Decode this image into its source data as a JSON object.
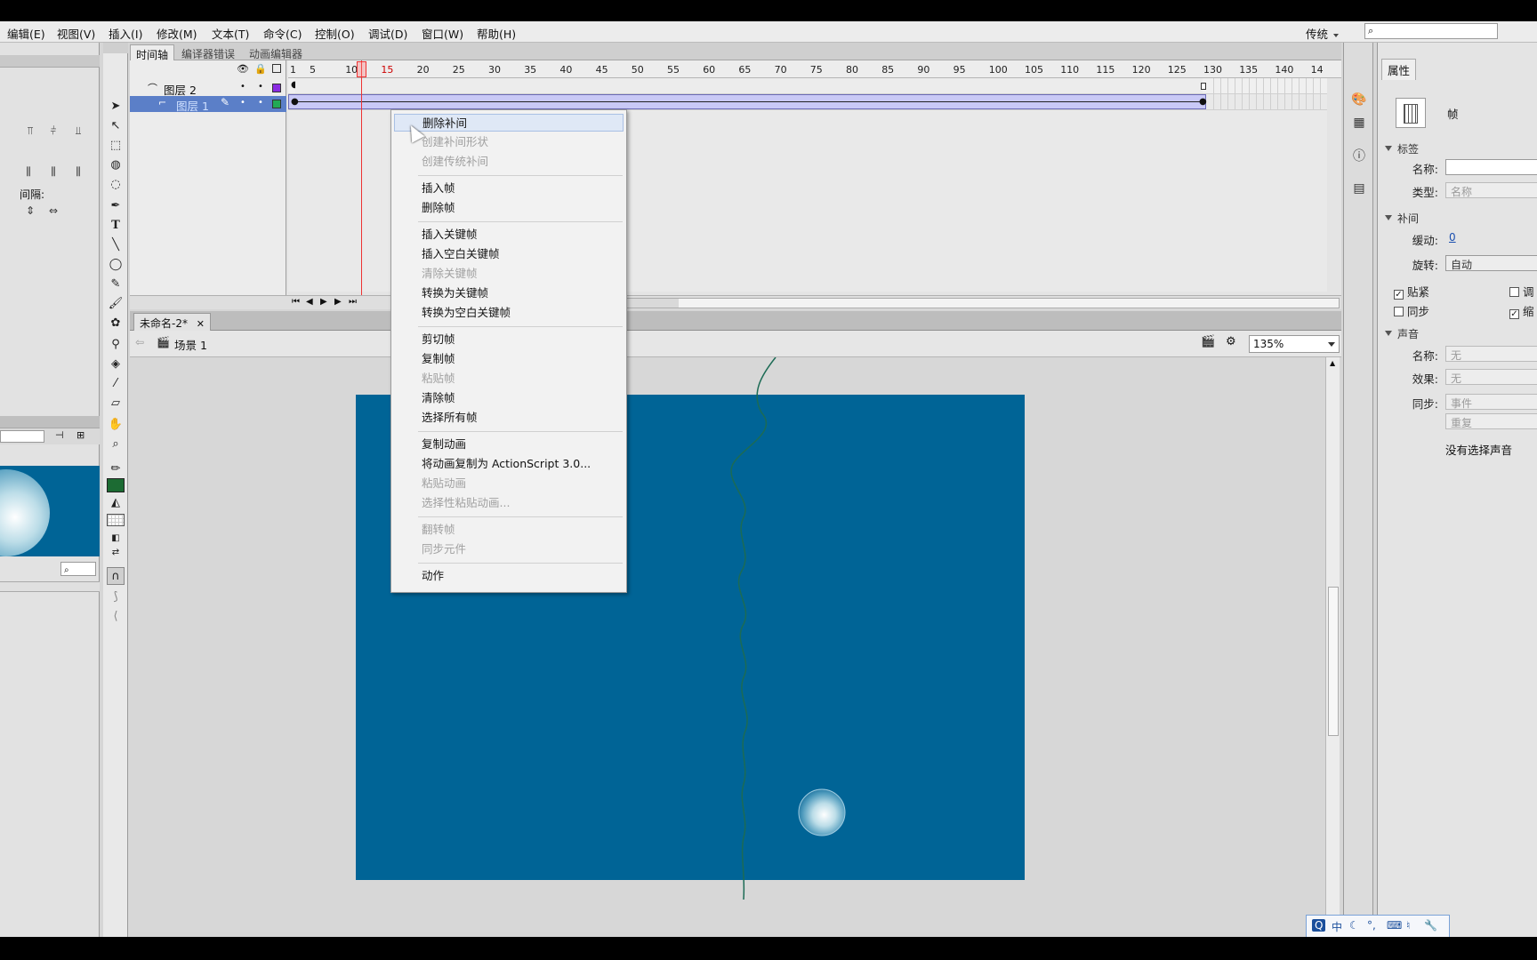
{
  "menubar": {
    "items": [
      "编辑(E)",
      "视图(V)",
      "插入(I)",
      "修改(M)",
      "文本(T)",
      "命令(C)",
      "控制(O)",
      "调试(D)",
      "窗口(W)",
      "帮助(H)"
    ],
    "workspace": "传统"
  },
  "left_panel": {
    "spacing_label": "间隔:"
  },
  "timeline": {
    "tabs": [
      "时间轴",
      "编译器错误",
      "动画编辑器"
    ],
    "layers": [
      {
        "name": "图层 2",
        "color": "#8a2be2"
      },
      {
        "name": "图层 1",
        "color": "#22aa55"
      }
    ],
    "frame_numbers": [
      "1",
      "5",
      "10",
      "15",
      "20",
      "25",
      "30",
      "35",
      "40",
      "45",
      "50",
      "55",
      "60",
      "65",
      "70",
      "75",
      "80",
      "85",
      "90",
      "95",
      "100",
      "105",
      "110",
      "115",
      "120",
      "125",
      "130",
      "135",
      "140",
      "14"
    ],
    "current_frame": 15
  },
  "document": {
    "tab_title": "未命名-2*",
    "scene": "场景 1",
    "zoom": "135%",
    "stage_color": "#006496"
  },
  "context_menu": {
    "items": [
      {
        "label": "删除补间",
        "enabled": true,
        "hover": true
      },
      {
        "label": "创建补间形状",
        "enabled": false
      },
      {
        "label": "创建传统补间",
        "enabled": false
      },
      {
        "sep": true
      },
      {
        "label": "插入帧",
        "enabled": true
      },
      {
        "label": "删除帧",
        "enabled": true
      },
      {
        "sep": true
      },
      {
        "label": "插入关键帧",
        "enabled": true
      },
      {
        "label": "插入空白关键帧",
        "enabled": true
      },
      {
        "label": "清除关键帧",
        "enabled": false
      },
      {
        "label": "转换为关键帧",
        "enabled": true
      },
      {
        "label": "转换为空白关键帧",
        "enabled": true
      },
      {
        "sep": true
      },
      {
        "label": "剪切帧",
        "enabled": true
      },
      {
        "label": "复制帧",
        "enabled": true
      },
      {
        "label": "粘贴帧",
        "enabled": false
      },
      {
        "label": "清除帧",
        "enabled": true
      },
      {
        "label": "选择所有帧",
        "enabled": true
      },
      {
        "sep": true
      },
      {
        "label": "复制动画",
        "enabled": true
      },
      {
        "label": "将动画复制为 ActionScript 3.0...",
        "enabled": true
      },
      {
        "label": "粘贴动画",
        "enabled": false
      },
      {
        "label": "选择性粘贴动画...",
        "enabled": false
      },
      {
        "sep": true
      },
      {
        "label": "翻转帧",
        "enabled": false
      },
      {
        "label": "同步元件",
        "enabled": false
      },
      {
        "sep": true
      },
      {
        "label": "动作",
        "enabled": true
      }
    ]
  },
  "properties": {
    "tab": "属性",
    "object_type": "帧",
    "label_section": "标签",
    "name_label": "名称:",
    "name_value": "",
    "type_label": "类型:",
    "type_value": "名称",
    "tween_section": "补间",
    "ease_label": "缓动:",
    "ease_value": "0",
    "rotate_label": "旋转:",
    "rotate_value": "自动",
    "snap_label": "贴紧",
    "adjust_label": "调",
    "sync_label": "同步",
    "scale_label": "缩",
    "sound_section": "声音",
    "sound_name_label": "名称:",
    "sound_name_value": "无",
    "effect_label": "效果:",
    "effect_value": "无",
    "sound_sync_label": "同步:",
    "sound_sync_value": "事件",
    "repeat_value": "重复",
    "no_sound": "没有选择声音"
  },
  "ime": {
    "items": [
      "中"
    ]
  }
}
